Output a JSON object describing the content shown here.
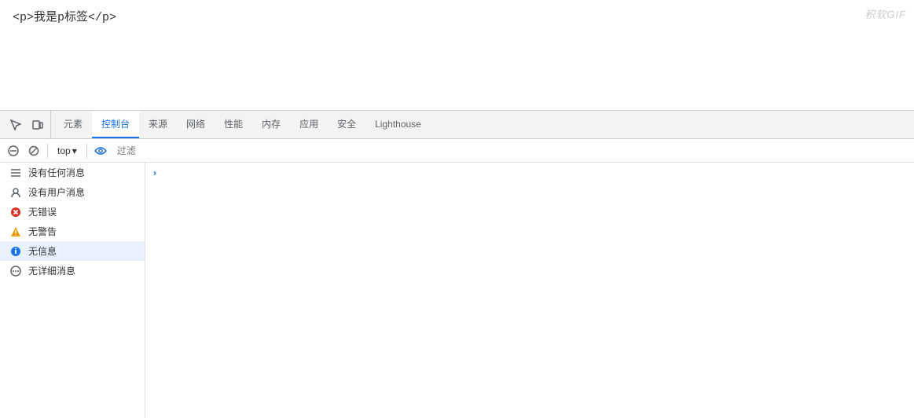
{
  "content": {
    "text": "<p>我是p标签</p>"
  },
  "watermark": "积软GIF",
  "tabs": {
    "icon_inspect": "⬚",
    "icon_device": "▭",
    "items": [
      {
        "label": "元素",
        "active": false
      },
      {
        "label": "控制台",
        "active": true
      },
      {
        "label": "来源",
        "active": false
      },
      {
        "label": "网络",
        "active": false
      },
      {
        "label": "性能",
        "active": false
      },
      {
        "label": "内存",
        "active": false
      },
      {
        "label": "应用",
        "active": false
      },
      {
        "label": "安全",
        "active": false
      },
      {
        "label": "Lighthouse",
        "active": false
      }
    ]
  },
  "toolbar": {
    "top_label": "top",
    "filter_placeholder": "过滤",
    "dropdown_arrow": "▾"
  },
  "sidebar": {
    "items": [
      {
        "label": "没有任何消息",
        "icon": "≡",
        "icon_class": "icon-list",
        "active": false
      },
      {
        "label": "没有用户消息",
        "icon": "👤",
        "icon_class": "icon-user",
        "active": false
      },
      {
        "label": "无错误",
        "icon": "✕",
        "icon_class": "icon-error",
        "active": false
      },
      {
        "label": "无警告",
        "icon": "⚠",
        "icon_class": "icon-warning",
        "active": false
      },
      {
        "label": "无信息",
        "icon": "ℹ",
        "icon_class": "icon-info",
        "active": true
      },
      {
        "label": "无详细消息",
        "icon": "⚙",
        "icon_class": "icon-verbose",
        "active": false
      }
    ]
  },
  "console": {
    "chevron": "›"
  }
}
